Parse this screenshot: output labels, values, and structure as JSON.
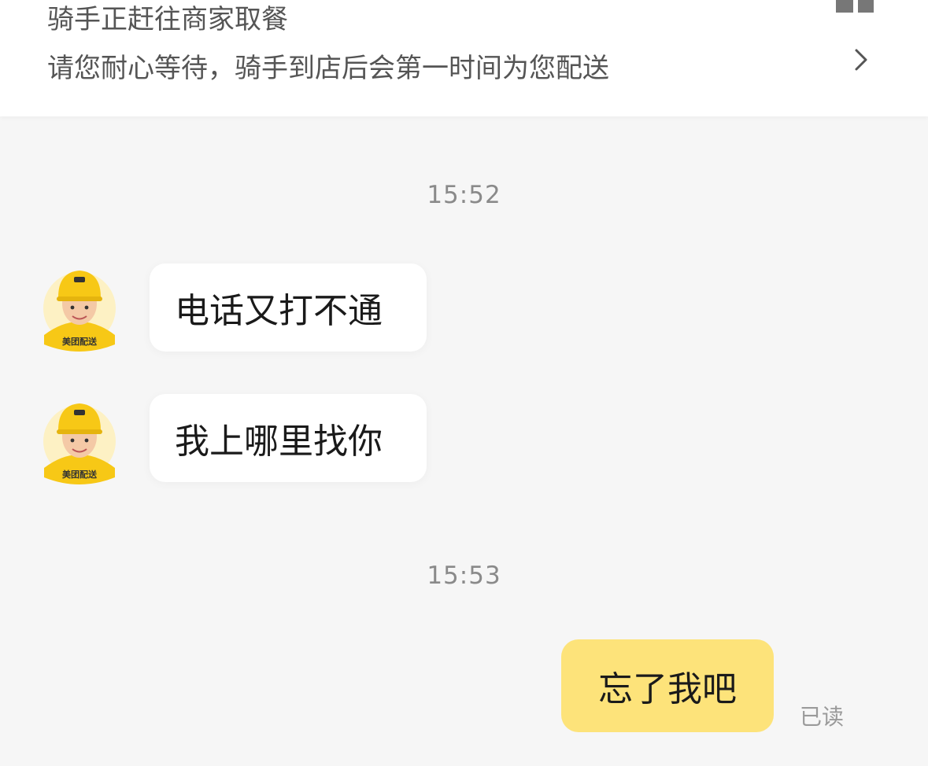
{
  "banner": {
    "title": "骑手正赶往商家取餐",
    "subtitle": "请您耐心等待，骑手到店后会第一时间为您配送",
    "chevron_icon": "chevron-right-icon"
  },
  "chat": {
    "timestamps": [
      "15:52",
      "15:53"
    ],
    "incoming": [
      {
        "text": "电话又打不通",
        "avatar_badge": "美团配送"
      },
      {
        "text": "我上哪里找你",
        "avatar_badge": "美团配送"
      }
    ],
    "outgoing": [
      {
        "text": "忘了我吧",
        "status": "已读"
      }
    ]
  },
  "colors": {
    "background": "#f6f6f6",
    "outgoing_bubble": "#fde37a",
    "incoming_bubble": "#ffffff",
    "avatar_yellow": "#f7c816"
  }
}
